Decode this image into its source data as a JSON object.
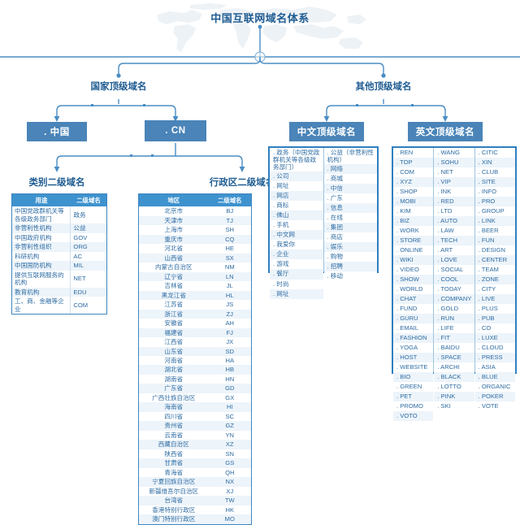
{
  "title": "中国互联网域名体系",
  "nodes": {
    "country_tld": "国家顶级域名",
    "other_tld": "其他顶级域名",
    "cn_hanzi": ". 中国",
    "cn_latin": ". CN",
    "chinese_tld": "中文顶级域名",
    "english_tld": "英文顶级域名"
  },
  "captions": {
    "category_sld": "类别二级域名",
    "admin_sld": "行政区二级域名"
  },
  "category_table": {
    "headers": [
      "用途",
      "二级域名"
    ],
    "rows": [
      [
        "中国党政群机关等各级政务部门",
        "政务"
      ],
      [
        "非营利性机构",
        "公益"
      ],
      [
        "中国政府机构",
        "GOV"
      ],
      [
        "非营利性组织",
        "ORG"
      ],
      [
        "科研机构",
        "AC"
      ],
      [
        "中国国防机构",
        "MIL"
      ],
      [
        "提供互联网服务的机构",
        "NET"
      ],
      [
        "教育机构",
        "EDU"
      ],
      [
        "工、商、金融等企业",
        "COM"
      ]
    ]
  },
  "admin_table": {
    "headers": [
      "地区",
      "二级域名"
    ],
    "rows": [
      [
        "北京市",
        "BJ"
      ],
      [
        "天津市",
        "TJ"
      ],
      [
        "上海市",
        "SH"
      ],
      [
        "重庆市",
        "CQ"
      ],
      [
        "河北省",
        "HE"
      ],
      [
        "山西省",
        "SX"
      ],
      [
        "内蒙古自治区",
        "NM"
      ],
      [
        "辽宁省",
        "LN"
      ],
      [
        "吉林省",
        "JL"
      ],
      [
        "黑龙江省",
        "HL"
      ],
      [
        "江苏省",
        "JS"
      ],
      [
        "浙江省",
        "ZJ"
      ],
      [
        "安徽省",
        "AH"
      ],
      [
        "福建省",
        "FJ"
      ],
      [
        "江西省",
        "JX"
      ],
      [
        "山东省",
        "SD"
      ],
      [
        "河南省",
        "HA"
      ],
      [
        "湖北省",
        "HB"
      ],
      [
        "湖南省",
        "HN"
      ],
      [
        "广东省",
        "GD"
      ],
      [
        "广西壮族自治区",
        "GX"
      ],
      [
        "海南省",
        "HI"
      ],
      [
        "四川省",
        "SC"
      ],
      [
        "贵州省",
        "GZ"
      ],
      [
        "云南省",
        "YN"
      ],
      [
        "西藏自治区",
        "XZ"
      ],
      [
        "陕西省",
        "SN"
      ],
      [
        "甘肃省",
        "GS"
      ],
      [
        "青海省",
        "QH"
      ],
      [
        "宁夏回族自治区",
        "NX"
      ],
      [
        "新疆维吾尔自治区",
        "XJ"
      ],
      [
        "台湾省",
        "TW"
      ],
      [
        "香港特别行政区",
        "HK"
      ],
      [
        "澳门特别行政区",
        "MO"
      ]
    ]
  },
  "chinese_tld_box": {
    "columns": [
      [
        ". 政务（中国党政群机关等各级政务部门）",
        ". 公司",
        ". 网址",
        ". 网店",
        ". 商标",
        ". 佛山",
        ". 手机",
        ". 中文网",
        ". 我爱你",
        ". 企业",
        ". 游戏",
        ". 餐厅",
        ". 时尚",
        ". 网址"
      ],
      [
        ". 公益（非营利性机构）",
        ". 网络",
        ". 商城",
        ". 中信",
        ". 广东",
        ". 信息",
        ". 在线",
        ". 集团",
        ". 商店",
        ". 娱乐",
        ". 购物",
        ". 招聘",
        ". 移动"
      ]
    ]
  },
  "english_tld_box": {
    "columns": [
      [
        ". REN",
        ". TOP",
        ". COM",
        ". XYZ",
        ". SHOP",
        ". MOBI",
        ". KIM",
        ". BIZ",
        ". WORK",
        ". STORE",
        ". ONLINE",
        ". WIKI",
        ". VIDEO",
        ". SHOW",
        ". WORLD",
        ". CHAT",
        ". FUND",
        ". GURU",
        ". EMAIL",
        ". FASHION",
        ". YOGA",
        ". HOST",
        ". WEBSITE",
        ". BIO",
        ". GREEN",
        ". PET",
        ". PROMO",
        ". VOTO"
      ],
      [
        ". WANG",
        ". SOHU",
        ". NET",
        ". VIP",
        ". INK",
        ". RED",
        ". LTD",
        ". AUTO",
        ". LAW",
        ". TECH",
        ". ART",
        ". LOVE",
        ". SOCIAL",
        ". COOL",
        ". TODAY",
        ". COMPANY",
        ". GOLD",
        ". RUN",
        ". LIFE",
        ". FIT",
        ". BAIDU",
        ". SPACE",
        ". ARCHI",
        ". BLACK",
        ". LOTTO",
        ". PINK",
        ". SKI"
      ],
      [
        ". CITIC",
        ". XIN",
        ". CLUB",
        ". SITE",
        ". INFO",
        ". PRO",
        ". GROUP",
        ". LINK",
        ". BEER",
        ". FUN",
        ". DESIGN",
        ". CENTER",
        ". TEAM",
        ". ZONE",
        ". CITY",
        ". LIVE",
        ". PLUS",
        ". PUB",
        ". CO",
        ". LUXE",
        ". CLOUD",
        ". PRESS",
        ". ASIA",
        ". BLUE",
        ". ORGANIC",
        ". POKER",
        ". VOTE"
      ]
    ]
  },
  "colors": {
    "box_fill": "#4a84b8",
    "table_header": "#3e92ce",
    "row_alt": "#edf4fa",
    "line": "#4a8dc4",
    "text_blue": "#1f5c92"
  }
}
